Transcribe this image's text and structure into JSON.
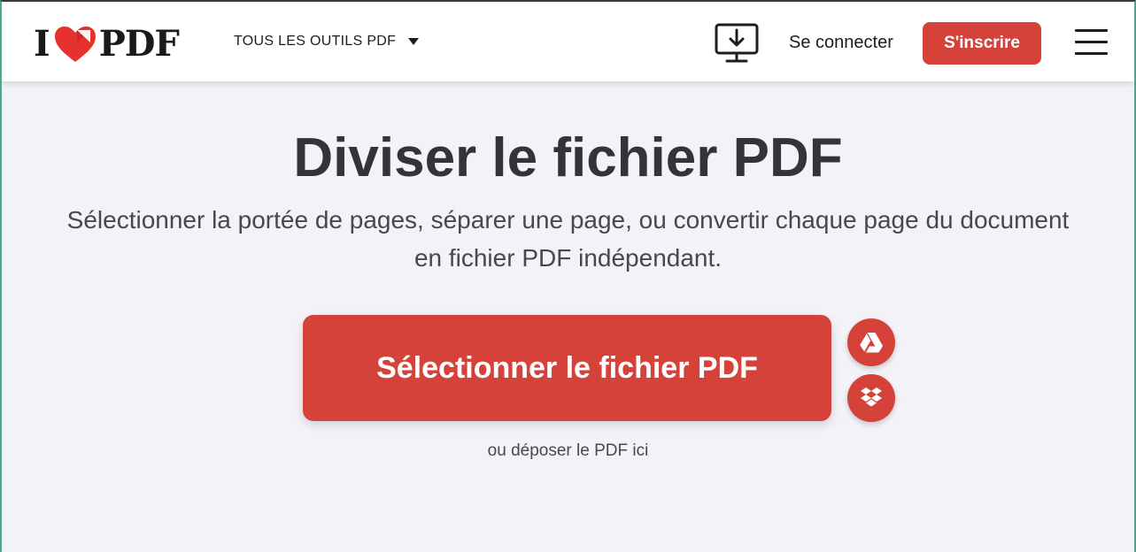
{
  "header": {
    "logo": {
      "text_left": "I",
      "text_right": "PDF",
      "icon": "heart-icon"
    },
    "tools_menu_label": "TOUS LES OUTILS PDF",
    "desktop_icon": "desktop-download-icon",
    "login_label": "Se connecter",
    "signup_label": "S'inscrire",
    "menu_icon": "hamburger-menu-icon"
  },
  "main": {
    "title": "Diviser le fichier PDF",
    "subtitle": "Sélectionner la portée de pages, séparer une page, ou convertir chaque page du document en fichier PDF indépendant.",
    "select_button_label": "Sélectionner le fichier PDF",
    "cloud_buttons": [
      {
        "icon": "google-drive-icon"
      },
      {
        "icon": "dropbox-icon"
      }
    ],
    "drop_hint": "ou déposer le PDF ici"
  },
  "colors": {
    "accent": "#d5423a",
    "background": "#f3f3f7",
    "header_background": "#ffffff",
    "text_dark": "#33333b"
  }
}
